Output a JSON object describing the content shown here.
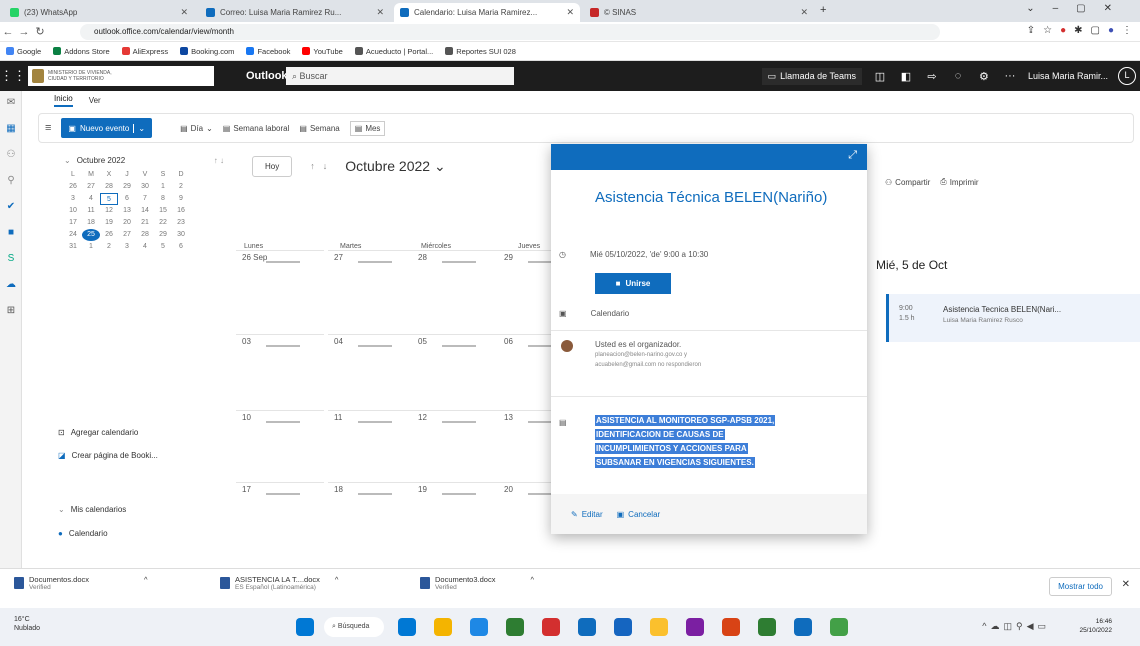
{
  "browser": {
    "tabs": [
      {
        "label": "(23) WhatsApp",
        "color": "#25d366",
        "active": false
      },
      {
        "label": "Correo: Luisa Maria Ramirez Ru...",
        "color": "#0f6cbd",
        "active": false
      },
      {
        "label": "Calendario: Luisa Maria Ramirez...",
        "color": "#0f6cbd",
        "active": true
      },
      {
        "label": "© SINAS",
        "color": "#c62828",
        "active": false
      }
    ],
    "url": "outlook.office.com/calendar/view/month",
    "bookmarks": [
      "Google",
      "Addons Store",
      "AliExpress",
      "Booking.com",
      "Facebook",
      "YouTube",
      "Acueducto | Portal...",
      "Reportes SUI 028"
    ]
  },
  "outlook": {
    "org_name_line1": "MINISTERIO DE VIVIENDA,",
    "org_name_line2": "CIUDAD Y TERRITORIO",
    "brand": "Outlook",
    "search_placeholder": "Buscar",
    "teams_call": "Llamada de Teams",
    "user_name": "Luisa Maria Ramir...",
    "ribbon_tabs": [
      "Inicio",
      "Ver"
    ],
    "new_event": "Nuevo evento",
    "views": [
      "Día",
      "Semana laboral",
      "Semana",
      "Mes"
    ],
    "share": "Compartir",
    "print": "Imprimir"
  },
  "mini_calendar": {
    "title": "Octubre 2022",
    "weekdays": [
      "L",
      "M",
      "X",
      "J",
      "V",
      "S",
      "D"
    ],
    "weeks": [
      [
        "26",
        "27",
        "28",
        "29",
        "30",
        "1",
        "2"
      ],
      [
        "3",
        "4",
        "5",
        "6",
        "7",
        "8",
        "9"
      ],
      [
        "10",
        "11",
        "12",
        "13",
        "14",
        "15",
        "16"
      ],
      [
        "17",
        "18",
        "19",
        "20",
        "21",
        "22",
        "23"
      ],
      [
        "24",
        "25",
        "26",
        "27",
        "28",
        "29",
        "30"
      ],
      [
        "31",
        "1",
        "2",
        "3",
        "4",
        "5",
        "6"
      ]
    ],
    "selected": "5",
    "today": "25"
  },
  "left_panel": {
    "add_calendar": "Agregar calendario",
    "create_booking": "Crear página de Booki...",
    "my_calendars": "Mis calendarios",
    "calendar": "Calendario"
  },
  "calendar": {
    "today_button": "Hoy",
    "month_title": "Octubre 2022",
    "day_headers": [
      "Lunes",
      "Martes",
      "Miércoles",
      "Jueves"
    ],
    "rows": [
      [
        "26 Sep",
        "27",
        "28",
        "29"
      ],
      [
        "03",
        "04",
        "05",
        "06"
      ],
      [
        "10",
        "11",
        "12",
        "13"
      ],
      [
        "17",
        "18",
        "19",
        "20"
      ]
    ]
  },
  "right_pane": {
    "date": "Mié, 5 de Oct",
    "event_time": "9:00",
    "event_duration": "1.5 h",
    "event_title": "Asistencia Tecnica BELEN(Nari...",
    "event_organizer": "Luisa Maria Ramirez Rusco"
  },
  "popup": {
    "title": "Asistencia Técnica BELEN(Nariño)",
    "datetime": "Mié 05/10/2022, 'de' 9:00 a 10:30",
    "join": "Unirse",
    "calendar": "Calendario",
    "organizer": "Usted es el organizador.",
    "attendee1": "planeacion@belen-narino.gov.co y",
    "attendee2": "acuabelen@gmail.com no respondieron",
    "description_lines": [
      "ASISTENCIA AL MONITOREO SGP-APSB 2021,",
      "IDENTIFICACION DE CAUSAS DE",
      "INCUMPLIMIENTOS Y ACCIONES PARA",
      "SUBSANAR EN VIGENCIAS SIGUIENTES."
    ],
    "edit": "Editar",
    "cancel": "Cancelar"
  },
  "downloads": [
    {
      "name": "Documentos.docx",
      "status": "Verified"
    },
    {
      "name": "ASISTENCIA LA T....docx",
      "status": "ES Español (Latinoamérica)"
    },
    {
      "name": "Documento3.docx",
      "status": "Verified"
    }
  ],
  "downloads_show_all": "Mostrar todo",
  "taskbar": {
    "weather_temp": "16°C",
    "weather_desc": "Nublado",
    "search": "Búsqueda",
    "time": "16:46",
    "date": "25/10/2022",
    "icon_colors": [
      "#0078d4",
      "#f4b400",
      "#1e88e5",
      "#2e7d32",
      "#d32f2f",
      "#0f6cbd",
      "#1565c0",
      "#fbc02d",
      "#7b1fa2",
      "#d84315",
      "#2e7d32",
      "#0f6cbd",
      "#43a047"
    ]
  }
}
